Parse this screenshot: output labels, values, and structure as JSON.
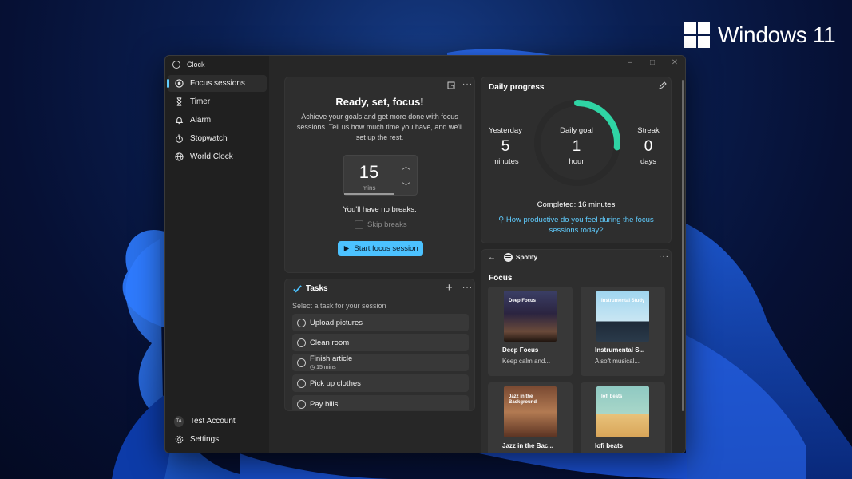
{
  "brand": {
    "text": "Windows 11"
  },
  "app": {
    "title": "Clock"
  },
  "window_controls": {
    "minimize": "–",
    "maximize": "□",
    "close": "✕"
  },
  "sidebar": {
    "items": [
      {
        "label": "Focus sessions",
        "icon": "focus-icon",
        "active": true
      },
      {
        "label": "Timer",
        "icon": "hourglass-icon"
      },
      {
        "label": "Alarm",
        "icon": "bell-icon"
      },
      {
        "label": "Stopwatch",
        "icon": "stopwatch-icon"
      },
      {
        "label": "World Clock",
        "icon": "globe-icon"
      }
    ],
    "account": {
      "initials": "TA",
      "name": "Test Account"
    },
    "settings": "Settings"
  },
  "focus": {
    "title": "Ready, set, focus!",
    "description": "Achieve your goals and get more done with focus sessions. Tell us how much time you have, and we'll set up the rest.",
    "minutes": "15",
    "minutes_unit": "mins",
    "breaks_text": "You'll have no breaks.",
    "skip_breaks": "Skip breaks",
    "start_button": "Start focus session",
    "more": "···"
  },
  "tasks": {
    "title": "Tasks",
    "add": "+",
    "more": "···",
    "subtitle": "Select a task for your session",
    "items": [
      {
        "label": "Upload pictures"
      },
      {
        "label": "Clean room"
      },
      {
        "label": "Finish article",
        "sub": "15 mins"
      },
      {
        "label": "Pick up clothes"
      },
      {
        "label": "Pay bills"
      }
    ]
  },
  "progress": {
    "title": "Daily progress",
    "yesterday": {
      "label": "Yesterday",
      "value": "5",
      "unit": "minutes"
    },
    "goal": {
      "label": "Daily goal",
      "value": "1",
      "unit": "hour"
    },
    "streak": {
      "label": "Streak",
      "value": "0",
      "unit": "days"
    },
    "goal_fraction": 0.267,
    "completed": "Completed: 16 minutes",
    "link": "How productive do you feel during the focus sessions today?",
    "accent": "#2fd4a4"
  },
  "spotify": {
    "brand": "Spotify",
    "more": "···",
    "section": "Focus",
    "playlists": [
      {
        "name": "Deep Focus",
        "desc": "Keep calm and...",
        "art_text": "Deep Focus"
      },
      {
        "name": "Instrumental S...",
        "desc": "A soft musical...",
        "art_text": "Instrumental Study"
      },
      {
        "name": "Jazz in the Bac...",
        "desc": "",
        "art_text": "Jazz in the Background"
      },
      {
        "name": "lofi beats",
        "desc": "",
        "art_text": "lofi beats"
      }
    ]
  }
}
